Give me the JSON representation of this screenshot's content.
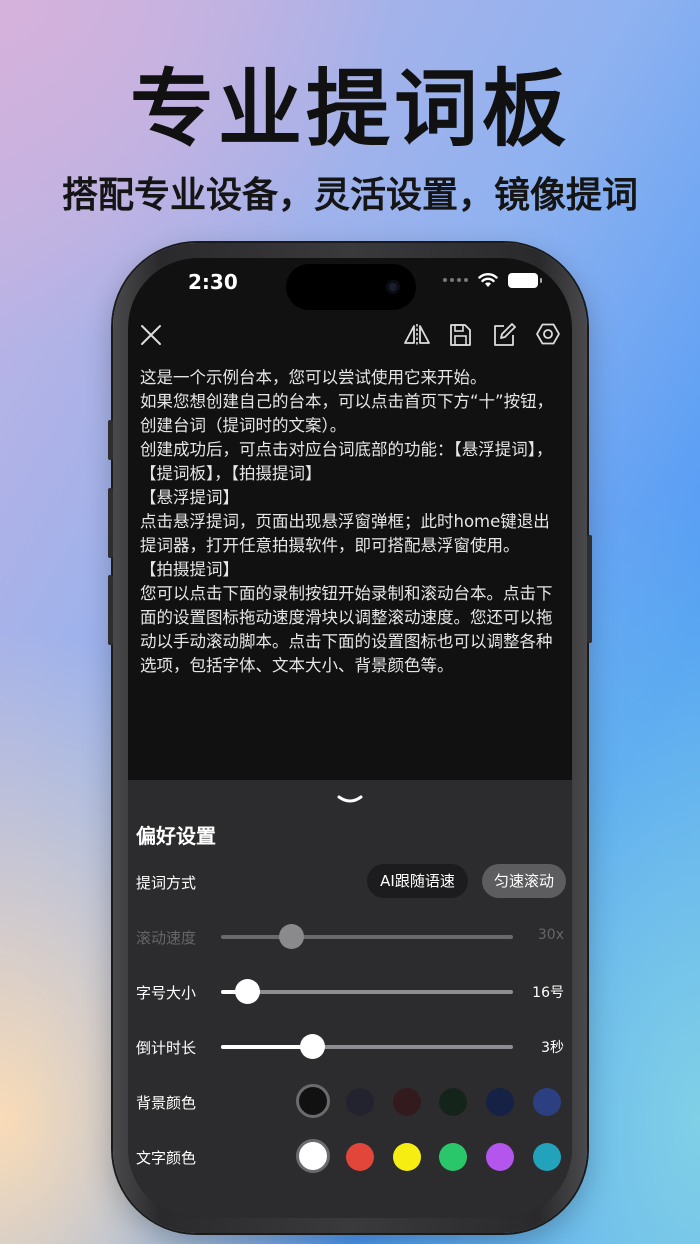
{
  "promo": {
    "headline": "专业提词板",
    "subline": "搭配专业设备，灵活设置，镜像提词"
  },
  "status_bar": {
    "time": "2:30"
  },
  "toolbar": {
    "icons": [
      "close-icon",
      "mirror-icon",
      "save-icon",
      "edit-icon",
      "settings-icon"
    ]
  },
  "script": {
    "paragraphs": [
      "这是一个示例台本，您可以尝试使用它来开始。",
      "如果您想创建自己的台本，可以点击首页下方“十”按钮，创建台词（提词时的文案）。",
      "创建成功后，可点击对应台词底部的功能：【悬浮提词】，【提词板】，【拍摄提词】",
      "【悬浮提词】",
      "点击悬浮提词，页面出现悬浮窗弹框；此时home键退出提词器，打开任意拍摄软件，即可搭配悬浮窗使用。",
      "【拍摄提词】",
      "您可以点击下面的录制按钮开始录制和滚动台本。点击下面的设置图标拖动速度滑块以调整滚动速度。您还可以拖动以手动滚动脚本。点击下面的设置图标也可以调整各种选项，包括字体、文本大小、背景颜色等。"
    ]
  },
  "settings": {
    "title": "偏好设置",
    "mode": {
      "label": "提词方式",
      "options": [
        {
          "label": "AI跟随语速",
          "active": true
        },
        {
          "label": "匀速滚动",
          "active": false
        }
      ]
    },
    "speed": {
      "label": "滚动速度",
      "value": "30x",
      "level": 0.24,
      "disabled": true
    },
    "font_size": {
      "label": "字号大小",
      "value": "16号",
      "level": 0.09
    },
    "countdown": {
      "label": "倒计时长",
      "value": "3秒",
      "level": 0.31
    },
    "background_color": {
      "label": "背景颜色",
      "colors": [
        "#111111",
        "#23232f",
        "#331b1d",
        "#15241b",
        "#152245",
        "#2c3f80"
      ],
      "selected": 0
    },
    "text_color": {
      "label": "文字颜色",
      "colors": [
        "#ffffff",
        "#e2463a",
        "#f6ee12",
        "#2ac76a",
        "#b455ee",
        "#23a2bb"
      ],
      "selected": 0
    }
  }
}
